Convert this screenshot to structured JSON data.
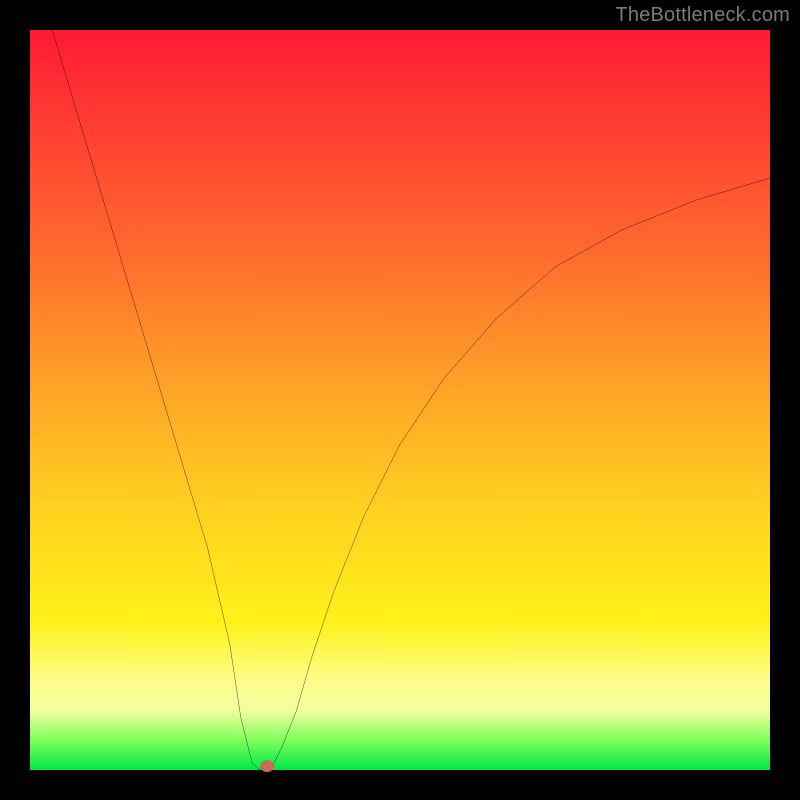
{
  "watermark": {
    "text": "TheBottleneck.com"
  },
  "colors": {
    "curve": "#000000",
    "marker": "#c96a5a",
    "frame": "#000000"
  },
  "chart_data": {
    "type": "line",
    "title": "",
    "xlabel": "",
    "ylabel": "",
    "xlim": [
      0,
      100
    ],
    "ylim": [
      0,
      100
    ],
    "grid": false,
    "annotations": [
      "TheBottleneck.com"
    ],
    "series": [
      {
        "name": "bottleneck-curve",
        "x": [
          3,
          6,
          9,
          12,
          15,
          18,
          21,
          24,
          27,
          28.5,
          30,
          31,
          32,
          33,
          34,
          36,
          38,
          41,
          45,
          50,
          56,
          63,
          71,
          80,
          90,
          100
        ],
        "y": [
          100,
          90,
          80,
          70,
          60,
          50,
          40,
          30,
          17,
          7,
          1,
          0,
          0,
          1,
          3,
          8,
          15,
          24,
          34,
          44,
          53,
          61,
          68,
          73,
          77,
          80
        ]
      }
    ],
    "marker": {
      "x": 32,
      "y": 0.5,
      "color": "#c96a5a"
    }
  }
}
